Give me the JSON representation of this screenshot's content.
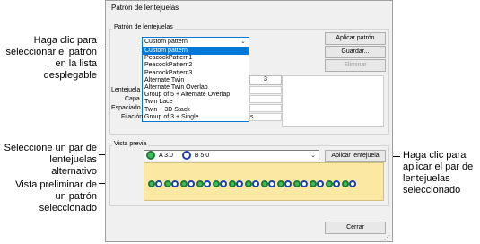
{
  "annotations": {
    "left_1": [
      "Haga clic para",
      "seleccionar el patrón",
      "en la lista",
      "desplegable"
    ],
    "left_2": [
      "Seleccione un par de",
      "lentejuelas",
      "alternativo"
    ],
    "left_3": [
      "Vista preliminar de",
      "un patrón",
      "seleccionado"
    ],
    "right_1": [
      "Haga clic para",
      "aplicar el par de",
      "lentejuelas",
      "seleccionado"
    ]
  },
  "dialog": {
    "title": "Patrón de lentejuelas",
    "group_pattern_label": "Patrón de lentejuelas",
    "selected_pattern": "Custom pattern",
    "buttons": {
      "apply_pattern": "Aplicar patrón",
      "save": "Guardar...",
      "delete": "Eliminar"
    },
    "dropdown_items": [
      "Custom pattern",
      "PeacockPattern1",
      "PeacockPattern2",
      "PeacockPattern3",
      "Alternate Twin",
      "Alternate Twin Overlap",
      "Group of 5 + Alternate Overlap",
      "Twin Lace",
      "Twin + 3D Stack",
      "Group of 3 + Single"
    ],
    "grid_header_col3": "3",
    "side_labels": [
      "Lentejuela",
      "Capa",
      "Espaciado",
      "Fijación"
    ],
    "field_fragment": "s",
    "group_preview_label": "Vista previa",
    "pair": {
      "a_label": "A 3.0",
      "b_label": "B 5.0"
    },
    "apply_sequin_button": "Aplicar lentejuela",
    "close_button": "Cerrar"
  },
  "colors": {
    "accent": "#0078d7",
    "preview_bg": "#fbe9a3",
    "sequin_a": "#3fbf5a",
    "sequin_b": "#1b3fae"
  }
}
